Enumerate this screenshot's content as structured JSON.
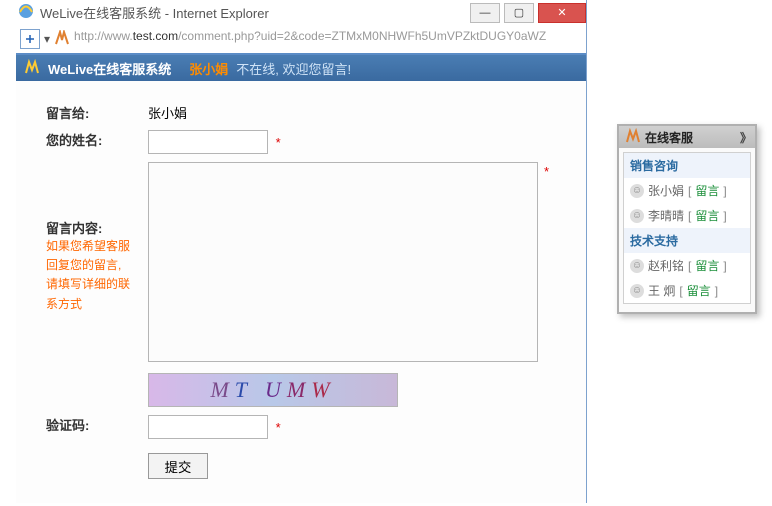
{
  "window": {
    "title": "WeLive在线客服系统 - Internet Explorer",
    "url_prefix": "http://www.",
    "url_host": "test.com",
    "url_path": "/comment.php?uid=2&code=ZTMxM0NHWFh5UmVPZktDUGY0aWZ",
    "min": "—",
    "max": "▢",
    "close": "✕"
  },
  "header": {
    "brand": "WeLive在线客服系统",
    "user": "张小娟",
    "status": "不在线, 欢迎您留言!"
  },
  "form": {
    "to_label": "留言给:",
    "to_value": "张小娟",
    "name_label": "您的姓名:",
    "name_value": "",
    "content_label": "留言内容:",
    "content_hint": "如果您希望客服回复您的留言, 请填写详细的联系方式",
    "content_value": "",
    "captcha_label": "验证码:",
    "captcha_value": "",
    "captcha_text_c1": "M",
    "captcha_text_c2": "T",
    "captcha_text_c3": "U",
    "captcha_text_c4": "M",
    "captcha_text_c5": "W",
    "submit_label": "提交",
    "required_mark": "*"
  },
  "panel": {
    "title": "在线客服",
    "collapse": "》",
    "groups": [
      {
        "title": "销售咨询",
        "members": [
          {
            "name": "张小娟",
            "action": "留言"
          },
          {
            "name": "李晴晴",
            "action": "留言"
          }
        ]
      },
      {
        "title": "技术支持",
        "members": [
          {
            "name": "赵利铭",
            "action": "留言"
          },
          {
            "name": "王 炯",
            "action": "留言"
          }
        ]
      }
    ]
  }
}
